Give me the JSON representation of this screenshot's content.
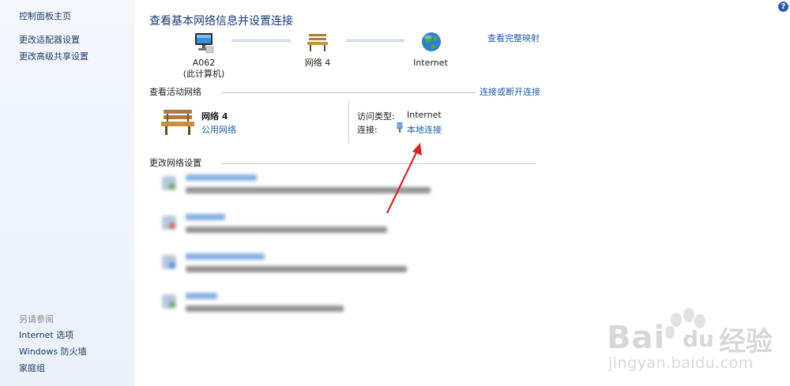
{
  "sidebar": {
    "home": "控制面板主页",
    "items": [
      "更改适配器设置",
      "更改高级共享设置"
    ],
    "see_also_title": "另请参阅",
    "see_also": [
      "Internet 选项",
      "Windows 防火墙",
      "家庭组"
    ]
  },
  "help_label": "?",
  "title": "查看基本网络信息并设置连接",
  "map": {
    "computer_name": "A062",
    "computer_sub": "(此计算机)",
    "network_name": "网络  4",
    "internet_name": "Internet",
    "full_map_link": "查看完整映射"
  },
  "active": {
    "section_title": "查看活动网络",
    "connect_link": "连接或断开连接",
    "network_name": "网络  4",
    "network_type": "公用网络",
    "access_type_key": "访问类型:",
    "access_type_value": "Internet",
    "connection_key": "连接:",
    "connection_value": "本地连接"
  },
  "change": {
    "section_title": "更改网络设置"
  },
  "watermark": {
    "brand_latin": "Bai",
    "brand_latin2": "du",
    "brand_cn": "经验",
    "url": "jingyan.baidu.com"
  },
  "colors": {
    "accent": "#1f5fae",
    "title": "#1a3a78",
    "sidebar_bg": "#eef4fb",
    "arrow": "#e02020"
  }
}
